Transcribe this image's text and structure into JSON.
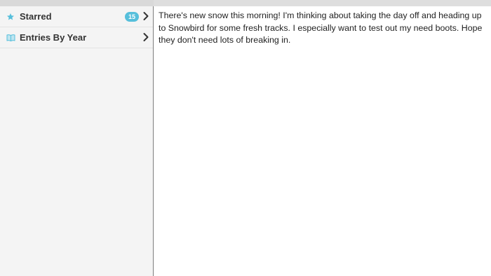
{
  "sidebar": {
    "items": [
      {
        "label": "Starred",
        "icon": "star-icon",
        "badge": "15"
      },
      {
        "label": "Entries By Year",
        "icon": "book-icon"
      }
    ]
  },
  "entry": {
    "text": "There's new snow this morning! I'm thinking about taking the day off and heading up to Snowbird for some fresh tracks. I especially want to test out my need boots. Hope they don't need lots of breaking in."
  },
  "colors": {
    "accent": "#56bfdb",
    "sidebar_bg": "#f4f4f4",
    "divider": "#7d7d7d"
  }
}
